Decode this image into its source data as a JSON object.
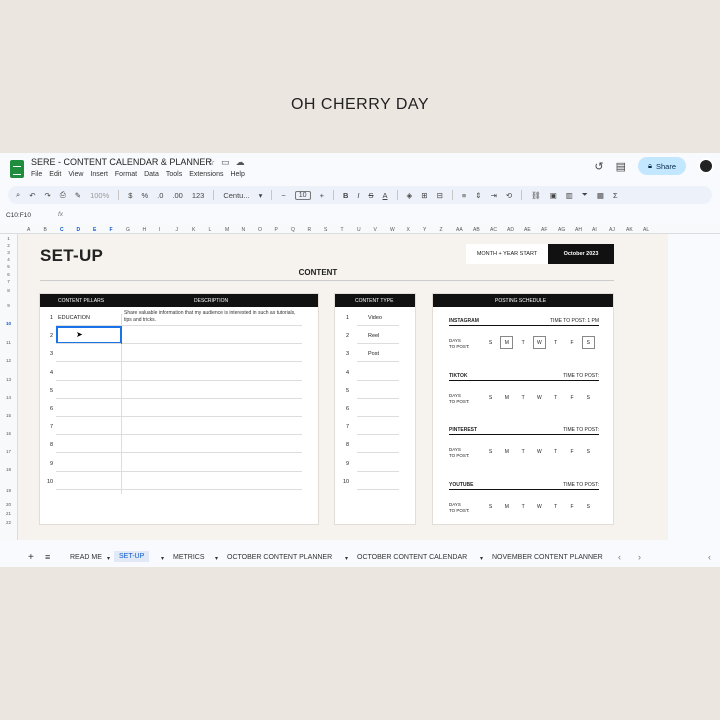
{
  "brand": "OH CHERRY DAY",
  "app": {
    "doc_title": "SERE - CONTENT CALENDAR & PLANNER",
    "menu": [
      "File",
      "Edit",
      "View",
      "Insert",
      "Format",
      "Data",
      "Tools",
      "Extensions",
      "Help"
    ],
    "share_label": "Share"
  },
  "toolbar": {
    "font_name": "Centu...",
    "font_size": "10",
    "number_format": "123",
    "percent": "%",
    "currency": "$",
    "zoom": "100%"
  },
  "formula": {
    "name_box": "C10:F10",
    "fx": "fx"
  },
  "columns": [
    "A",
    "B",
    "C",
    "D",
    "E",
    "F",
    "G",
    "H",
    "I",
    "J",
    "K",
    "L",
    "M",
    "N",
    "O",
    "P",
    "Q",
    "R",
    "S",
    "T",
    "U",
    "V",
    "W",
    "X",
    "Y",
    "Z",
    "AA",
    "AB",
    "AC",
    "AD",
    "AE",
    "AF",
    "AG",
    "AH",
    "AI",
    "AJ",
    "AK",
    "AL"
  ],
  "rows": [
    "1",
    "2",
    "3",
    "4",
    "5",
    "6",
    "7",
    "8",
    "9",
    "10",
    "11",
    "12",
    "13",
    "14",
    "15",
    "16",
    "17",
    "18",
    "19",
    "20",
    "21",
    "22"
  ],
  "setup": {
    "title": "SET-UP",
    "month_label": "MONTH + YEAR START",
    "month_value": "October 2023",
    "section_title": "CONTENT"
  },
  "pillars": {
    "header_left": "CONTENT PILLARS",
    "header_right": "DESCRIPTION",
    "first_value": "EDUCATION",
    "first_description": "Share valuable information that my audience is interested in such as tutorials, tips and tricks.",
    "numbers": [
      "1",
      "2",
      "3",
      "4",
      "5",
      "6",
      "7",
      "8",
      "9",
      "10"
    ]
  },
  "content_type": {
    "header": "CONTENT TYPE",
    "numbers": [
      "1",
      "2",
      "3",
      "4",
      "5",
      "6",
      "7",
      "8",
      "9",
      "10"
    ],
    "values": [
      "Video",
      "Reel",
      "Post"
    ]
  },
  "schedule": {
    "header": "POSTING SCHEDULE",
    "days_label_1": "DAYS",
    "days_label_2": "TO POST:",
    "day_letters": [
      "S",
      "M",
      "T",
      "W",
      "T",
      "F",
      "S"
    ],
    "platforms": [
      {
        "name": "INSTAGRAM",
        "time": "TIME TO POST: 1 PM",
        "selected": [
          1,
          3,
          6
        ]
      },
      {
        "name": "TIKTOK",
        "time": "TIME TO POST:",
        "selected": []
      },
      {
        "name": "PINTEREST",
        "time": "TIME TO POST:",
        "selected": []
      },
      {
        "name": "YOUTUBE",
        "time": "TIME TO POST:",
        "selected": []
      }
    ]
  },
  "tabs": [
    "READ ME",
    "SET-UP",
    "METRICS",
    "OCTOBER CONTENT PLANNER",
    "OCTOBER CONTENT CALENDAR",
    "NOVEMBER CONTENT PLANNER"
  ],
  "active_tab": "SET-UP"
}
